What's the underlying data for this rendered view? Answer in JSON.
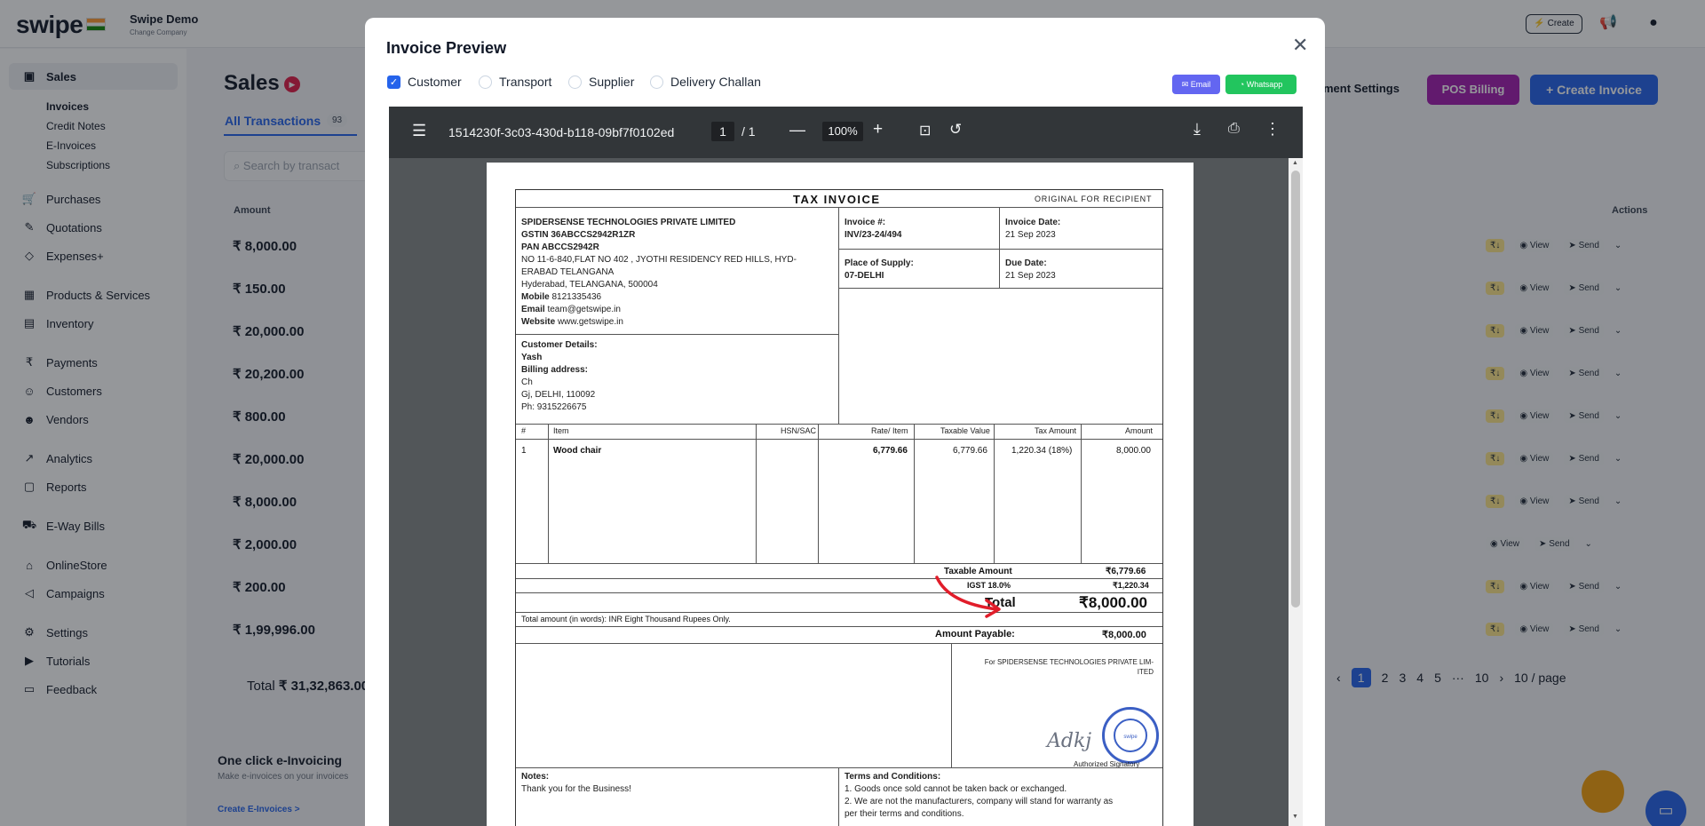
{
  "app": {
    "logo": "swipe",
    "company_name": "Swipe Demo",
    "company_sub": "Change Company",
    "create_label": "Create"
  },
  "sidebar": {
    "sales": "Sales",
    "sales_sub": [
      "Invoices",
      "Credit Notes",
      "E-Invoices",
      "Subscriptions"
    ],
    "items": [
      {
        "label": "Purchases",
        "icon": "cart-icon"
      },
      {
        "label": "Quotations",
        "icon": "pencil-icon"
      },
      {
        "label": "Expenses+",
        "icon": "tag-icon"
      },
      {
        "label": "Products & Services",
        "icon": "box-icon"
      },
      {
        "label": "Inventory",
        "icon": "warehouse-icon"
      },
      {
        "label": "Payments",
        "icon": "rupee-icon"
      },
      {
        "label": "Customers",
        "icon": "user-icon"
      },
      {
        "label": "Vendors",
        "icon": "users-icon"
      },
      {
        "label": "Analytics",
        "icon": "chart-icon"
      },
      {
        "label": "Reports",
        "icon": "report-icon"
      },
      {
        "label": "E-Way Bills",
        "icon": "truck-icon"
      },
      {
        "label": "OnlineStore",
        "icon": "store-icon"
      },
      {
        "label": "Campaigns",
        "icon": "megaphone-icon"
      },
      {
        "label": "Settings",
        "icon": "gear-icon"
      },
      {
        "label": "Tutorials",
        "icon": "youtube-icon"
      },
      {
        "label": "Feedback",
        "icon": "chat-icon"
      }
    ]
  },
  "main": {
    "title": "Sales",
    "tab_all": "All Transactions",
    "tab_count": "93",
    "search_placeholder": "Search by transact",
    "col_amount": "Amount",
    "col_actions": "Actions",
    "rows": [
      "₹ 8,000.00",
      "₹ 150.00",
      "₹ 20,000.00",
      "₹ 20,200.00",
      "₹ 800.00",
      "₹ 20,000.00",
      "₹ 8,000.00",
      "₹ 2,000.00",
      "₹ 200.00",
      "₹ 1,99,996.00"
    ],
    "total_label": "Total",
    "total_value": "₹ 31,32,863.00",
    "settings_link": "ment Settings",
    "pos_billing": "POS Billing",
    "create_invoice": "+ Create Invoice",
    "action_view": "View",
    "action_send": "Send",
    "pager": [
      "1",
      "2",
      "3",
      "4",
      "5",
      "···",
      "10",
      "10 / page"
    ],
    "einvoicing_title": "One click e-Invoicing",
    "einvoicing_sub": "Make e-invoices on your invoices",
    "einvoicing_link": "Create E-Invoices >"
  },
  "modal": {
    "title": "Invoice Preview",
    "options": [
      {
        "label": "Customer",
        "checked": true
      },
      {
        "label": "Transport",
        "checked": false
      },
      {
        "label": "Supplier",
        "checked": false
      },
      {
        "label": "Delivery Challan",
        "checked": false
      }
    ],
    "email_btn": "Email",
    "whatsapp_btn": "Whatsapp"
  },
  "viewer": {
    "filename": "1514230f-3c03-430d-b118-09bf7f0102ed",
    "page": "1",
    "page_total": "/  1",
    "zoom": "100%"
  },
  "invoice": {
    "title": "TAX INVOICE",
    "original": "ORIGINAL FOR RECIPIENT",
    "seller_name": "SPIDERSENSE TECHNOLOGIES PRIVATE LIMITED",
    "gstin": "GSTIN 36ABCCS2942R1ZR",
    "pan": "PAN ABCCS2942R",
    "address1": "NO 11-6-840,FLAT NO 402 , JYOTHI RESIDENCY RED HILLS, HYD-",
    "address2": "ERABAD TELANGANA",
    "address3": "Hyderabad, TELANGANA, 500004",
    "mobile_label": "Mobile",
    "mobile": "8121335436",
    "email_label": "Email",
    "email": "team@getswipe.in",
    "website_label": "Website",
    "website": "www.getswipe.in",
    "invoice_no_label": "Invoice #:",
    "invoice_no": "INV/23-24/494",
    "invoice_date_label": "Invoice Date:",
    "invoice_date": "21 Sep 2023",
    "pos_label": "Place of Supply:",
    "pos": "07-DELHI",
    "due_label": "Due Date:",
    "due": "21 Sep 2023",
    "cust_label": "Customer Details:",
    "cust_name": "Yash",
    "billing_label": "Billing address:",
    "bill1": "Ch",
    "bill2": "Gj, DELHI, 110092",
    "phone": "Ph: 9315226675",
    "cols": [
      "#",
      "Item",
      "HSN/SAC",
      "Rate/ Item",
      "Taxable Value",
      "Tax Amount",
      "Amount"
    ],
    "item": {
      "no": "1",
      "name": "Wood chair",
      "rate": "6,779.66",
      "taxable": "6,779.66",
      "tax": "1,220.34 (18%)",
      "amount": "8,000.00"
    },
    "taxable_amount_label": "Taxable Amount",
    "taxable_amount": "₹6,779.66",
    "igst_label": "IGST 18.0%",
    "igst": "₹1,220.34",
    "total_label": "Total",
    "total": "₹8,000.00",
    "in_words": "Total amount (in words): INR Eight Thousand Rupees Only.",
    "payable_label": "Amount Payable:",
    "payable": "₹8,000.00",
    "for_company1": "For SPIDERSENSE TECHNOLOGIES PRIVATE LIM-",
    "for_company2": "ITED",
    "stamp_text": "swipe",
    "authorized": "Authorized Signatory",
    "notes_label": "Notes:",
    "notes": "Thank you for the Business!",
    "terms_label": "Terms and Conditions:",
    "terms1": "1. Goods once sold cannot be taken back or exchanged.",
    "terms2": "2. We are not the manufacturers, company will stand for warranty as",
    "terms3": "per their terms and conditions."
  }
}
